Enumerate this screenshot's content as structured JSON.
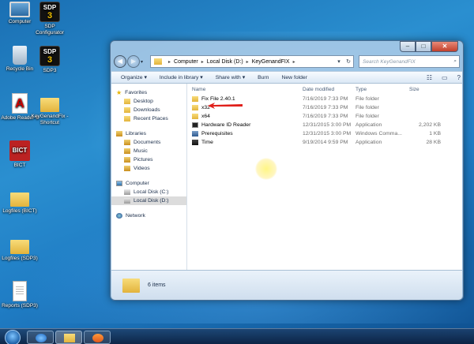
{
  "desktop": {
    "icons": [
      {
        "label": "Computer",
        "icon": "computer-icon"
      },
      {
        "label": "SDP Configurator",
        "icon": "sdp-icon"
      },
      {
        "label": "Recycle Bin",
        "icon": "recycle-bin-icon"
      },
      {
        "label": "SDP3",
        "icon": "sdp-icon"
      },
      {
        "label": "Adobe Reader 9",
        "icon": "pdf-icon"
      },
      {
        "label": "KeyGenandFix - Shortcut",
        "icon": "folder-icon"
      },
      {
        "label": "BICT",
        "icon": "bict-icon"
      },
      {
        "label": "Logfiles (BICT)",
        "icon": "folder-icon"
      },
      {
        "label": "Logfiles (SDP3)",
        "icon": "folder-icon"
      },
      {
        "label": "Reports (SDP3)",
        "icon": "document-icon"
      }
    ],
    "sdp_logo_top": "SDP",
    "sdp_logo_num": "3",
    "bict_logo": "BICT",
    "pdf_logo": "A"
  },
  "window": {
    "caption": {
      "minimize": "–",
      "maximize": "□",
      "close": "✕"
    },
    "nav": {
      "back": "◀",
      "forward": "▶",
      "dropdown": "▾"
    },
    "address": {
      "segments": [
        "Computer",
        "Local Disk (D:)",
        "KeyGenandFIX"
      ],
      "separator": "▸",
      "dropdown": "▾",
      "refresh": "↻"
    },
    "search": {
      "placeholder": "Search KeyGenandFIX",
      "icon": "⌕"
    },
    "toolbar": {
      "organize": "Organize ▾",
      "include": "Include in library ▾",
      "share": "Share with ▾",
      "burn": "Burn",
      "new_folder": "New folder",
      "views": "☷",
      "preview": "▭",
      "help": "?"
    },
    "navpane": {
      "favorites": {
        "label": "Favorites",
        "items": [
          "Desktop",
          "Downloads",
          "Recent Places"
        ]
      },
      "libraries": {
        "label": "Libraries",
        "items": [
          "Documents",
          "Music",
          "Pictures",
          "Videos"
        ]
      },
      "computer": {
        "label": "Computer",
        "items": [
          "Local Disk (C:)",
          "Local Disk (D:)"
        ]
      },
      "network": {
        "label": "Network"
      }
    },
    "columns": {
      "name": "Name",
      "date": "Date modified",
      "type": "Type",
      "size": "Size"
    },
    "files": [
      {
        "name": "Fix File 2.40.1",
        "date": "7/16/2019 7:33 PM",
        "type": "File folder",
        "size": "",
        "icon": "folder"
      },
      {
        "name": "x32",
        "date": "7/16/2019 7:33 PM",
        "type": "File folder",
        "size": "",
        "icon": "folder"
      },
      {
        "name": "x64",
        "date": "7/16/2019 7:33 PM",
        "type": "File folder",
        "size": "",
        "icon": "folder"
      },
      {
        "name": "Hardware ID Reader",
        "date": "12/31/2015 3:00 PM",
        "type": "Application",
        "size": "2,202 KB",
        "icon": "app"
      },
      {
        "name": "Prerequisites",
        "date": "12/31/2015 3:00 PM",
        "type": "Windows Comma...",
        "size": "1 KB",
        "icon": "setup"
      },
      {
        "name": "Time",
        "date": "9/19/2014 9:59 PM",
        "type": "Application",
        "size": "28 KB",
        "icon": "time"
      }
    ],
    "status": {
      "count": "6 items"
    }
  },
  "colors": {
    "arrow": "#e0201b",
    "highlight": "#fff27a",
    "desktop": "#1f7cc4"
  }
}
